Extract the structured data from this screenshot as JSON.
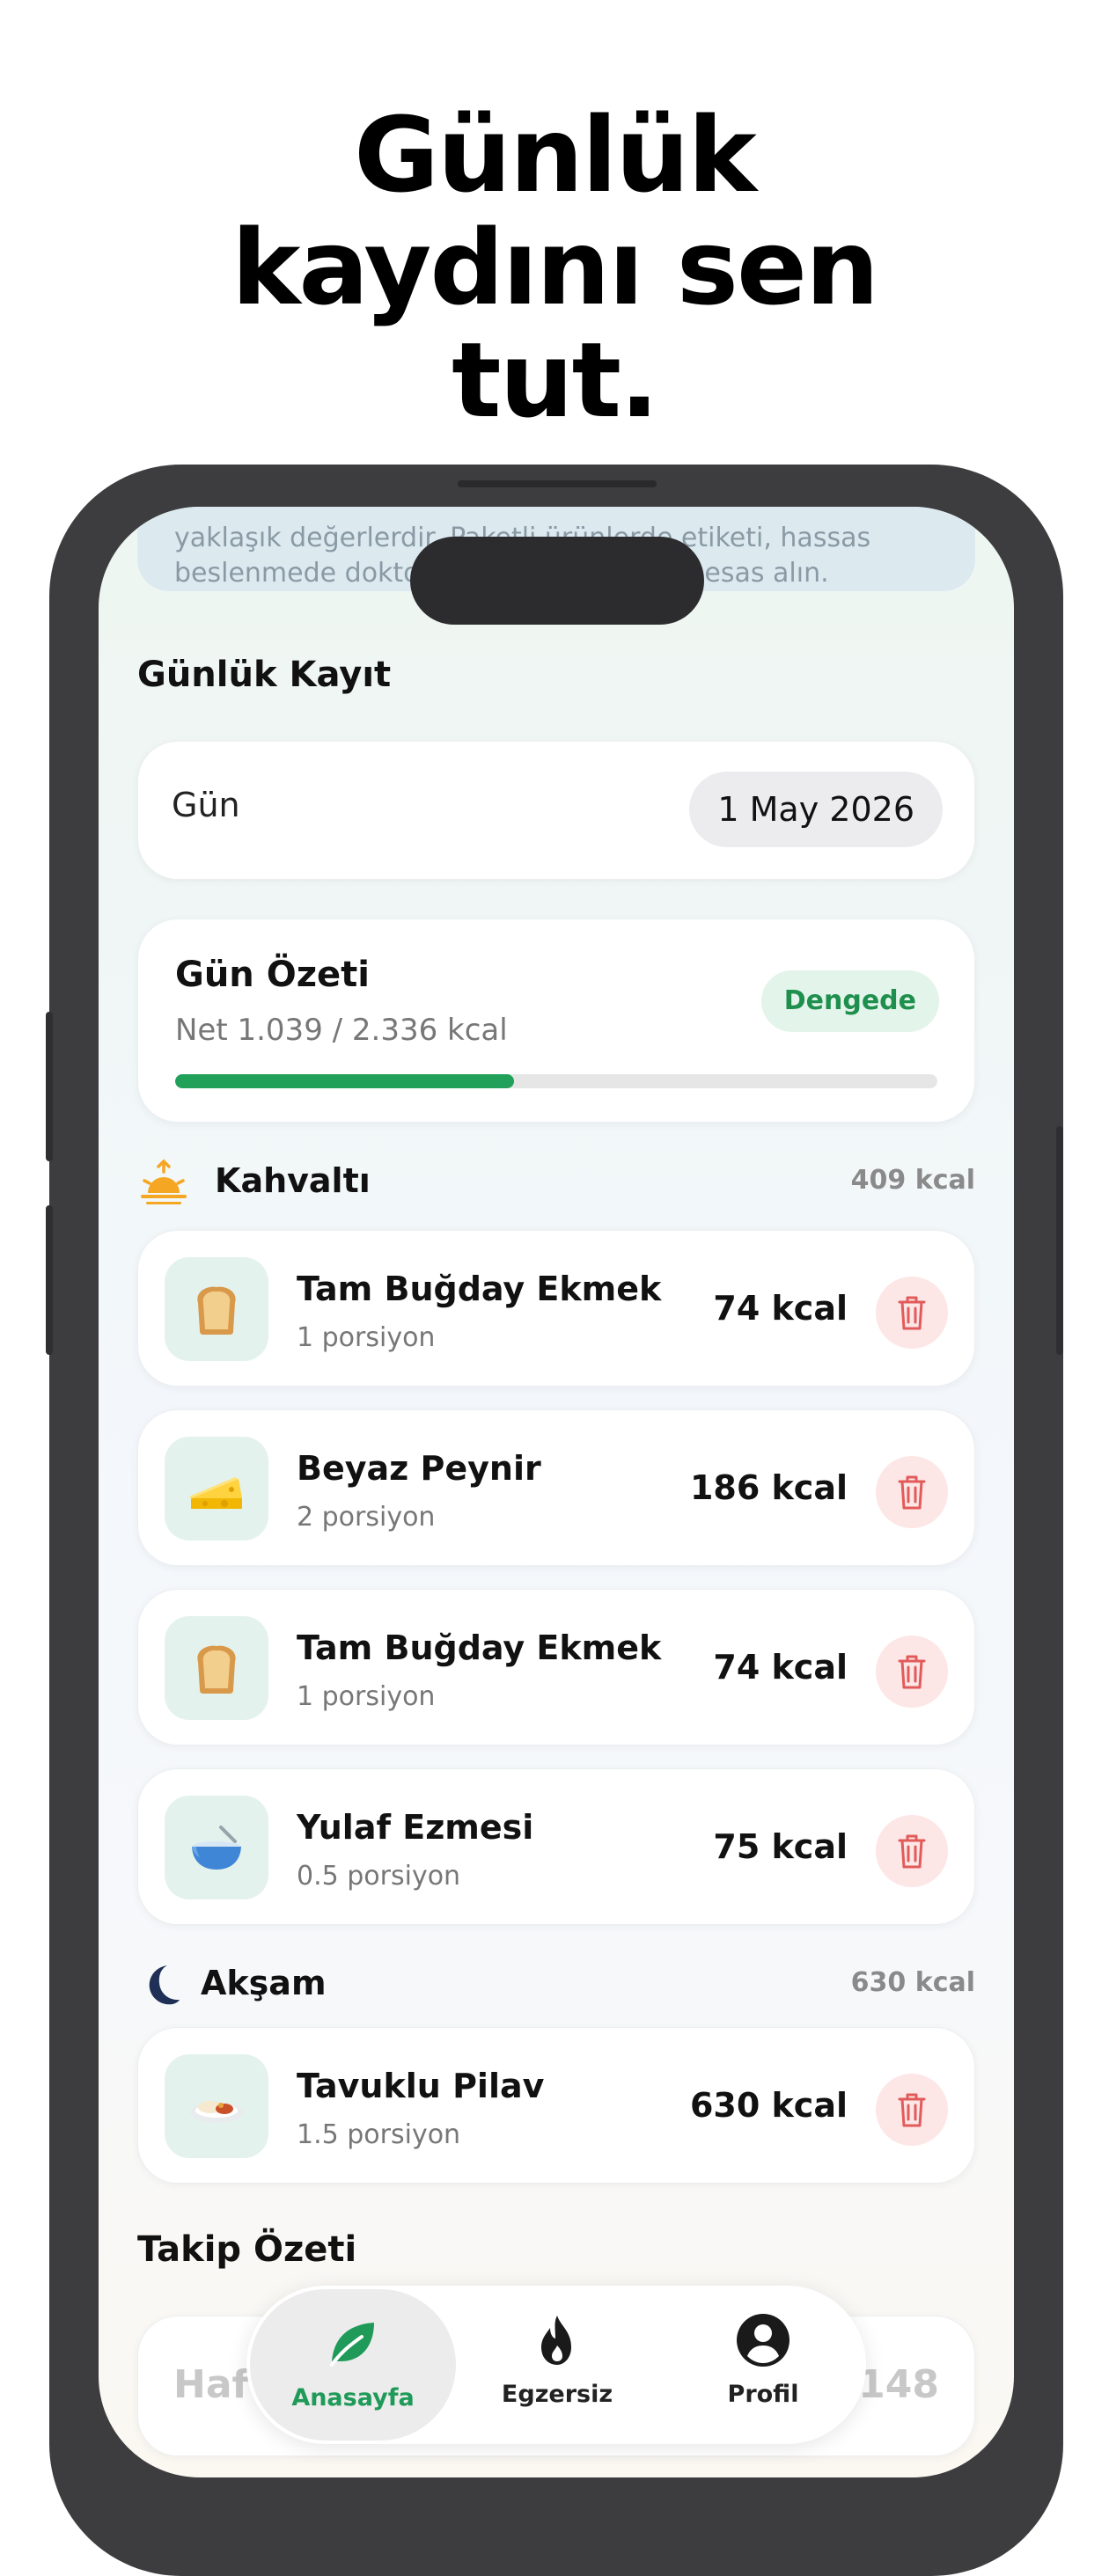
{
  "headline": {
    "line1": "Günlük",
    "line2": "kaydını sen",
    "line3": "tut."
  },
  "disclaimer": {
    "line1": "yaklaşık değerlerdir. Paketli ürünlerde etiketi, hassas",
    "line2": "beslenmede doktor/diyetisyen önerisini esas alın."
  },
  "daily_log": {
    "title": "Günlük Kayıt",
    "day_label": "Gün",
    "date": "1 May 2026"
  },
  "summary": {
    "title": "Gün Özeti",
    "net": "Net 1.039 / 2.336 kcal",
    "badge": "Dengede",
    "progress_fraction": 0.445,
    "accent": "#21a05a"
  },
  "meals": [
    {
      "name": "Kahvaltı",
      "icon": "sunrise-icon",
      "total": "409 kcal",
      "items": [
        {
          "name": "Tam Buğday Ekmek",
          "portion": "1 porsiyon",
          "kcal": "74 kcal",
          "icon": "bread-icon"
        },
        {
          "name": "Beyaz Peynir",
          "portion": "2 porsiyon",
          "kcal": "186 kcal",
          "icon": "cheese-icon"
        },
        {
          "name": "Tam Buğday Ekmek",
          "portion": "1 porsiyon",
          "kcal": "74 kcal",
          "icon": "bread-icon"
        },
        {
          "name": "Yulaf Ezmesi",
          "portion": "0.5 porsiyon",
          "kcal": "75 kcal",
          "icon": "bowl-icon"
        }
      ]
    },
    {
      "name": "Akşam",
      "icon": "moon-icon",
      "total": "630 kcal",
      "items": [
        {
          "name": "Tavuklu Pilav",
          "portion": "1.5 porsiyon",
          "kcal": "630 kcal",
          "icon": "rice-plate-icon"
        }
      ]
    }
  ],
  "tracking": {
    "title": "Takip Özeti",
    "left_partial": "Haft",
    "right_partial": "148"
  },
  "tabs": [
    {
      "label": "Anasayfa",
      "icon": "leaf-icon",
      "active": true
    },
    {
      "label": "Egzersiz",
      "icon": "flame-icon",
      "active": false
    },
    {
      "label": "Profil",
      "icon": "person-icon",
      "active": false
    }
  ],
  "colors": {
    "active_tab": "#1f9a58",
    "delete": "#e25b5b",
    "thumb_bg": "#e3f2ec"
  }
}
